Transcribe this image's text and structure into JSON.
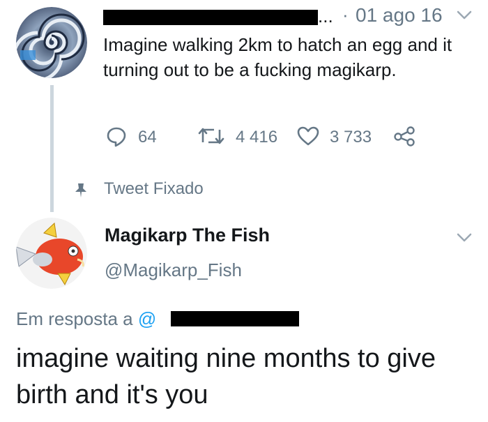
{
  "pinned_tweet": {
    "author_name_redacted": "████ ██████",
    "ellipsis": "...",
    "separator": "·",
    "date": "01 ago 16",
    "text": "Imagine walking 2km to hatch an egg and it turning out to be a fucking magikarp.",
    "reply_count": "64",
    "retweet_count": "4 416",
    "like_count": "3 733",
    "pinned_label": "Tweet Fixado"
  },
  "reply_tweet": {
    "author_name": "Magikarp The Fish",
    "handle": "@Magikarp_Fish",
    "reply_to_prefix": "Em resposta a",
    "reply_to_handle": "@",
    "text": "imagine waiting nine months to give birth and it's you"
  },
  "icons": {
    "reply": "reply-bubble-icon",
    "retweet": "retweet-icon",
    "like": "heart-icon",
    "share": "share-icon",
    "pin": "pin-icon",
    "chevron": "chevron-down-icon"
  },
  "colors": {
    "text": "#14171a",
    "secondary": "#657786",
    "accent": "#1da1f2",
    "thread_line": "#ccd6dd"
  }
}
